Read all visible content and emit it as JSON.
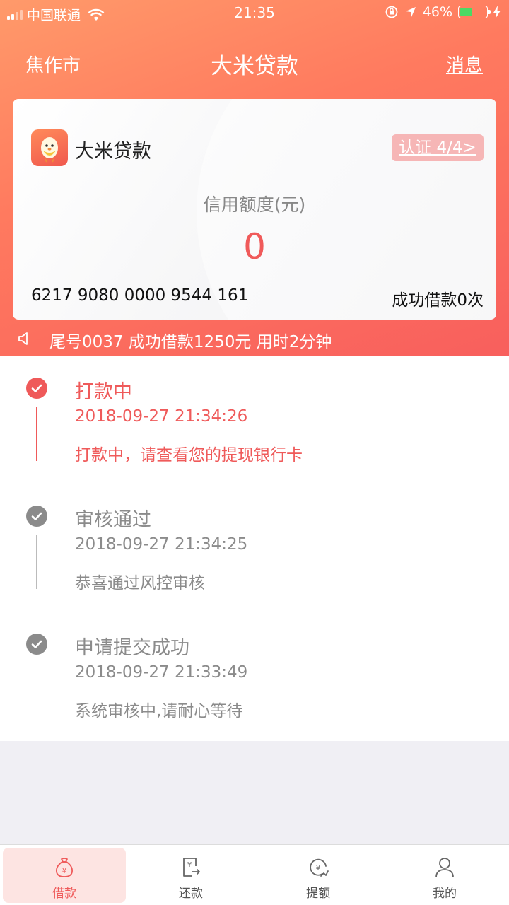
{
  "status_bar": {
    "carrier": "中国联通",
    "time": "21:35",
    "battery": "46%",
    "battery_level": 0.46
  },
  "nav": {
    "city": "焦作市",
    "title": "大米贷款",
    "message": "消息"
  },
  "card": {
    "brand": "大米贷款",
    "auth_button": "认证 4/4>",
    "credit_label": "信用额度(元)",
    "credit_value": "0",
    "card_number": "6217 9080 0000 9544 161",
    "loan_count": "成功借款0次"
  },
  "notice": {
    "text": "尾号0037 成功借款1250元 用时2分钟"
  },
  "timeline": [
    {
      "title": "打款中",
      "time": "2018-09-27 21:34:26",
      "desc": "打款中，请查看您的提现银行卡",
      "state": "active"
    },
    {
      "title": "审核通过",
      "time": "2018-09-27 21:34:25",
      "desc": "恭喜通过风控审核",
      "state": "done"
    },
    {
      "title": "申请提交成功",
      "time": "2018-09-27 21:33:49",
      "desc": "系统审核中,请耐心等待",
      "state": "done"
    }
  ],
  "tabs": [
    {
      "label": "借款",
      "icon": "loan-bag-icon",
      "selected": true
    },
    {
      "label": "还款",
      "icon": "repay-bill-icon",
      "selected": false
    },
    {
      "label": "提额",
      "icon": "raise-limit-icon",
      "selected": false
    },
    {
      "label": "我的",
      "icon": "user-icon",
      "selected": false
    }
  ],
  "colors": {
    "accent": "#ef5a5a",
    "header_start": "#ff9a6a",
    "header_end": "#f85f5d",
    "done_gray": "#8b8b8b",
    "tab_selected_bg": "#fde4e2"
  }
}
